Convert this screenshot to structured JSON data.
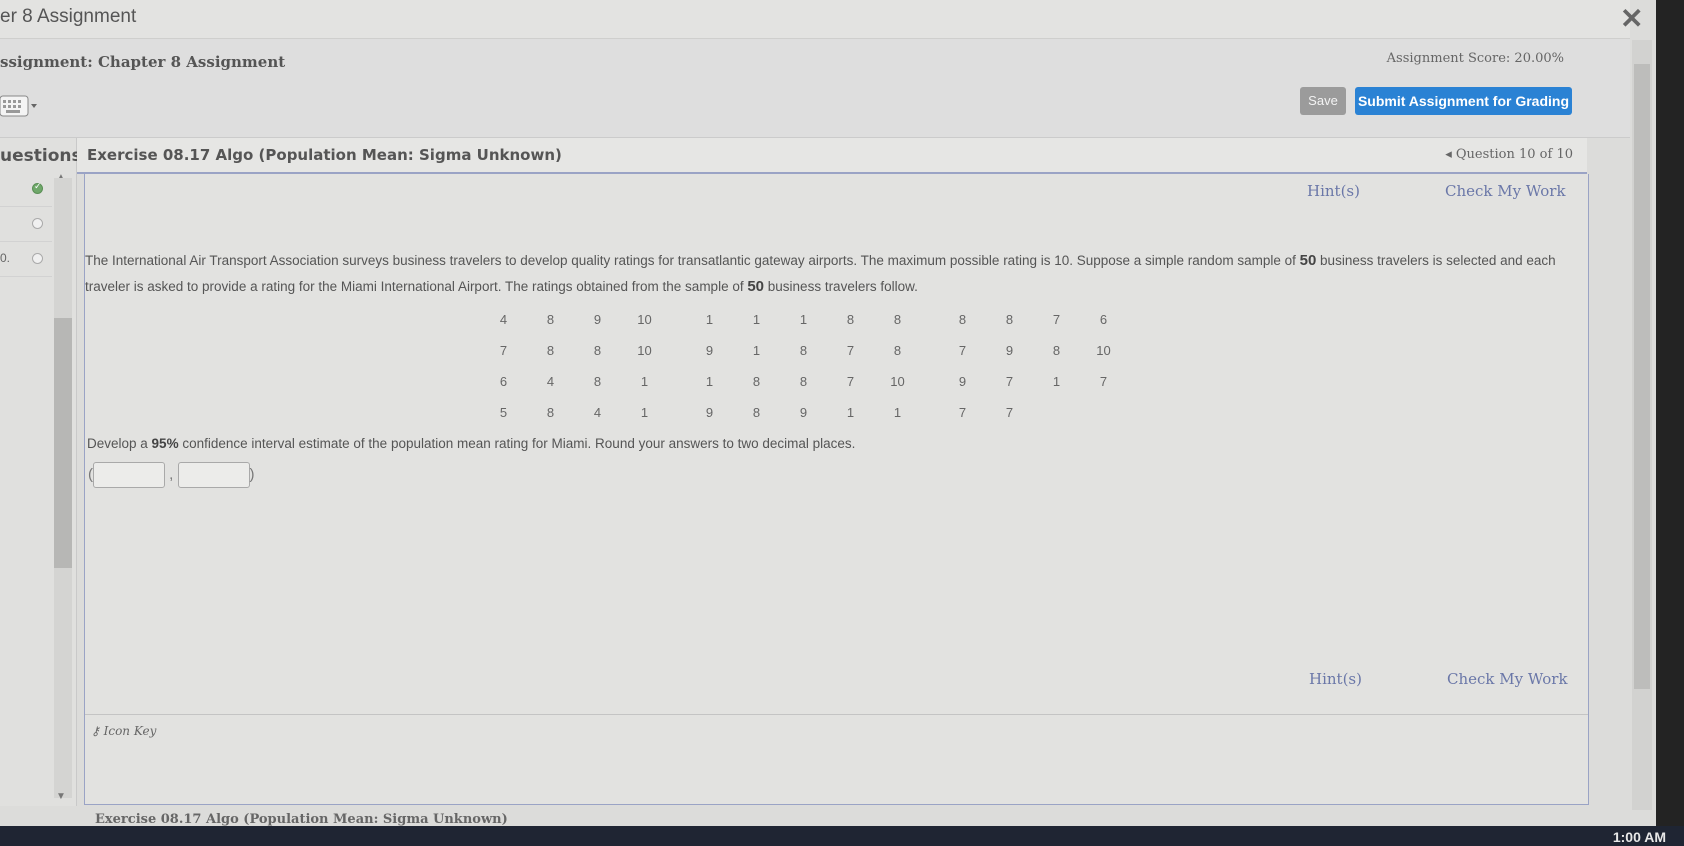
{
  "window": {
    "title": "er 8 Assignment",
    "close_glyph": "✕"
  },
  "assignment": {
    "title": "ssignment: Chapter 8 Assignment",
    "score": "Assignment Score: 20.00%",
    "save_label": "Save",
    "submit_label": "Submit Assignment for Grading"
  },
  "questions_panel": {
    "label": "uestions",
    "items": [
      {
        "num": "",
        "status": "completed"
      },
      {
        "num": "",
        "status": "open"
      },
      {
        "num": "0.",
        "status": "open"
      }
    ]
  },
  "exercise": {
    "title": "Exercise 08.17 Algo (Population Mean: Sigma Unknown)",
    "nav": "◂ Question 10 of 10",
    "hint_label": "Hint(s)",
    "check_label": "Check My Work",
    "problem_part1": "The International Air Transport Association surveys business travelers to develop quality ratings for transatlantic gateway airports. The maximum possible rating is 10. Suppose a simple random sample of ",
    "sample_size": "50",
    "problem_part2": " business travelers is selected and each traveler is asked to provide a rating for the Miami International Airport. The ratings obtained from the sample of ",
    "problem_part3": " business travelers follow.",
    "ratings": [
      [
        "4",
        "8",
        "9",
        "10",
        "",
        "1",
        "1",
        "1",
        "8",
        "8",
        "",
        "8",
        "8",
        "7",
        "6"
      ],
      [
        "7",
        "8",
        "8",
        "10",
        "",
        "9",
        "1",
        "8",
        "7",
        "8",
        "",
        "7",
        "9",
        "8",
        "10"
      ],
      [
        "6",
        "4",
        "8",
        "1",
        "",
        "1",
        "8",
        "8",
        "7",
        "10",
        "",
        "9",
        "7",
        "1",
        "7"
      ],
      [
        "5",
        "8",
        "4",
        "1",
        "",
        "9",
        "8",
        "9",
        "1",
        "1",
        "",
        "7",
        "7",
        "",
        ""
      ]
    ],
    "task_part1": "Develop a ",
    "confidence": "95%",
    "task_part2": " confidence interval estimate of the population mean rating for Miami. Round your answers to two decimal places.",
    "answer_lower": "",
    "answer_upper": "",
    "icon_key": "Icon Key",
    "footer_title": "Exercise 08.17 Algo (Population Mean: Sigma Unknown)"
  },
  "taskbar": {
    "clock": "1:00 AM"
  }
}
